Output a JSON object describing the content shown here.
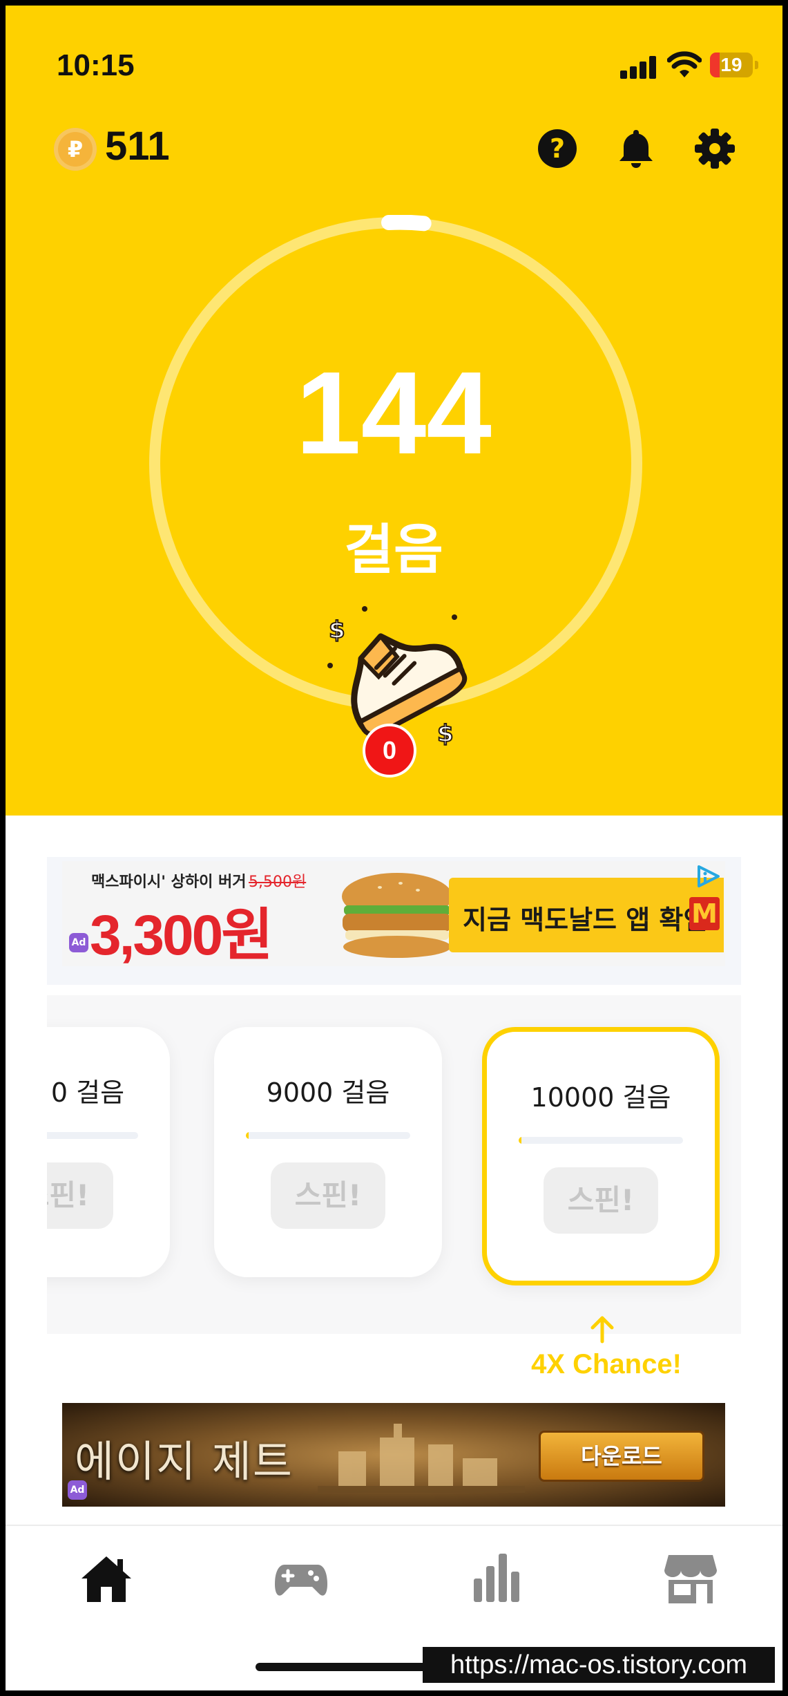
{
  "status_bar": {
    "time": "10:15",
    "battery": "19"
  },
  "header": {
    "coin_symbol": "₽",
    "coin_count": "511"
  },
  "pedometer": {
    "steps": "144",
    "steps_unit": "걸음",
    "spin_tickets": "0",
    "ring_progress": 0.014
  },
  "ad_banner_1": {
    "headline": "맥스파이시' 상하이 버거",
    "old_price": "5,500원",
    "price": "3,300원",
    "cta": "지금 맥도날드 앱 확인",
    "logo": "M",
    "ad_badge": "Ad"
  },
  "spin_cards": [
    {
      "label": "0 걸음",
      "button": "스핀!",
      "progress": 0.0
    },
    {
      "label": "9000 걸음",
      "button": "스핀!",
      "progress": 0.01
    },
    {
      "label": "10000 걸음",
      "button": "스핀!",
      "progress": 0.01
    }
  ],
  "chance": {
    "text": "4X Chance!"
  },
  "ad_banner_2": {
    "title": "에이지 제트",
    "cta": "다운로드",
    "ad_badge": "Ad"
  },
  "tabs": [
    {
      "icon": "home-icon",
      "active": true
    },
    {
      "icon": "gamepad-icon",
      "active": false
    },
    {
      "icon": "bar-chart-icon",
      "active": false
    },
    {
      "icon": "store-icon",
      "active": false
    }
  ],
  "watermark": "https://mac-os.tistory.com",
  "colors": {
    "brand_yellow": "#FED100",
    "badge_red": "#F01616",
    "inactive_icon": "#8A8A8A"
  }
}
